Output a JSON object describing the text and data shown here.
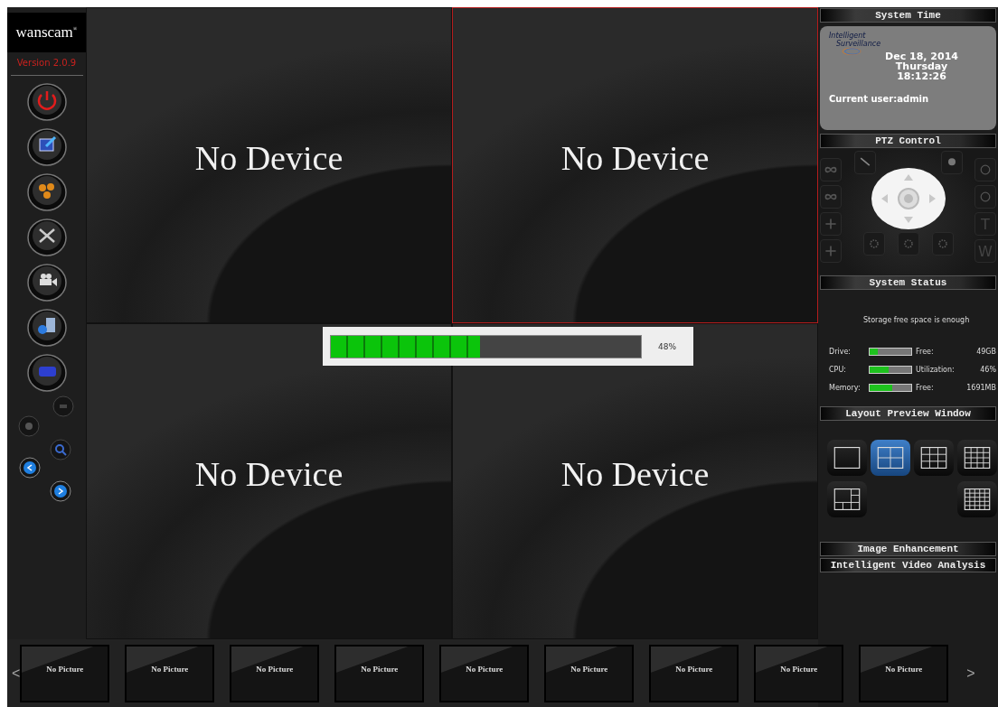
{
  "sidebar": {
    "logo": "wanscam",
    "logo_mark": "®",
    "version": "Version 2.0.9"
  },
  "video_grid": [
    {
      "label": "No Device",
      "selected": false
    },
    {
      "label": "No Device",
      "selected": true
    },
    {
      "label": "No Device",
      "selected": false
    },
    {
      "label": "No Device",
      "selected": false
    }
  ],
  "progress": {
    "level": 0.48,
    "reading": "48%"
  },
  "thumbnails": {
    "prev": "<",
    "next": ">",
    "items": [
      "No Picture",
      "No Picture",
      "No Picture",
      "No Picture",
      "No Picture",
      "No Picture",
      "No Picture",
      "No Picture",
      "No Picture"
    ]
  },
  "system_time": {
    "title": "System Time",
    "logo_lines": [
      "Intelligent",
      "Surveillance"
    ],
    "date": "Dec 18, 2014",
    "weekday": "Thursday",
    "time": "18:12:26",
    "user": "Current user:admin"
  },
  "ptz": {
    "title": "PTZ Control",
    "right_keys": [
      "T",
      "W"
    ]
  },
  "system_status": {
    "title": "System Status",
    "message": "Storage free space is enough",
    "rows": [
      {
        "label": "Drive:",
        "level": 0.2,
        "key": "Free:",
        "value": "49GB"
      },
      {
        "label": "CPU:",
        "level": 0.46,
        "key": "Utilization:",
        "value": "46%"
      },
      {
        "label": "Memory:",
        "level": 0.55,
        "key": "Free:",
        "value": "1691MB"
      }
    ]
  },
  "layout_preview": {
    "title": "Layout Preview Window",
    "options": [
      {
        "kind": "single",
        "selected": false
      },
      {
        "kind": "quad",
        "selected": true
      },
      {
        "kind": "nine",
        "selected": false
      },
      {
        "kind": "sixteen",
        "selected": false
      },
      {
        "kind": "mixed",
        "selected": false
      },
      {
        "kind": "twentyfive",
        "selected": false
      }
    ]
  },
  "sections": [
    "Image Enhancement",
    "Intelligent Video Analysis"
  ]
}
